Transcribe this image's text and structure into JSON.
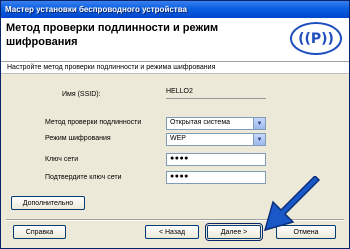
{
  "window": {
    "title": "Мастер установки беспроводного устройства"
  },
  "header": {
    "title": "Метод проверки подлинности и режим шифрования",
    "logo_text": "((P))"
  },
  "subtitle": "Настройте метод проверки подлинности и режима шифрования",
  "form": {
    "ssid_label": "Имя (SSID):",
    "ssid_value": "HELLO2",
    "auth_label": "Метод проверки подлинности",
    "auth_value": "Открытая система",
    "enc_label": "Режим шифрования",
    "enc_value": "WEP",
    "key_label": "Ключ сети",
    "key_value": "●●●●",
    "confirm_label": "Подтвердите ключ сети",
    "confirm_value": "●●●●"
  },
  "buttons": {
    "advanced": "Дополнительно",
    "help": "Справка",
    "back": "< Назад",
    "next": "Далее >",
    "cancel": "Отмена"
  },
  "icons": {
    "dropdown": "chevron-down-icon",
    "pointer": "blue-arrow-icon"
  }
}
